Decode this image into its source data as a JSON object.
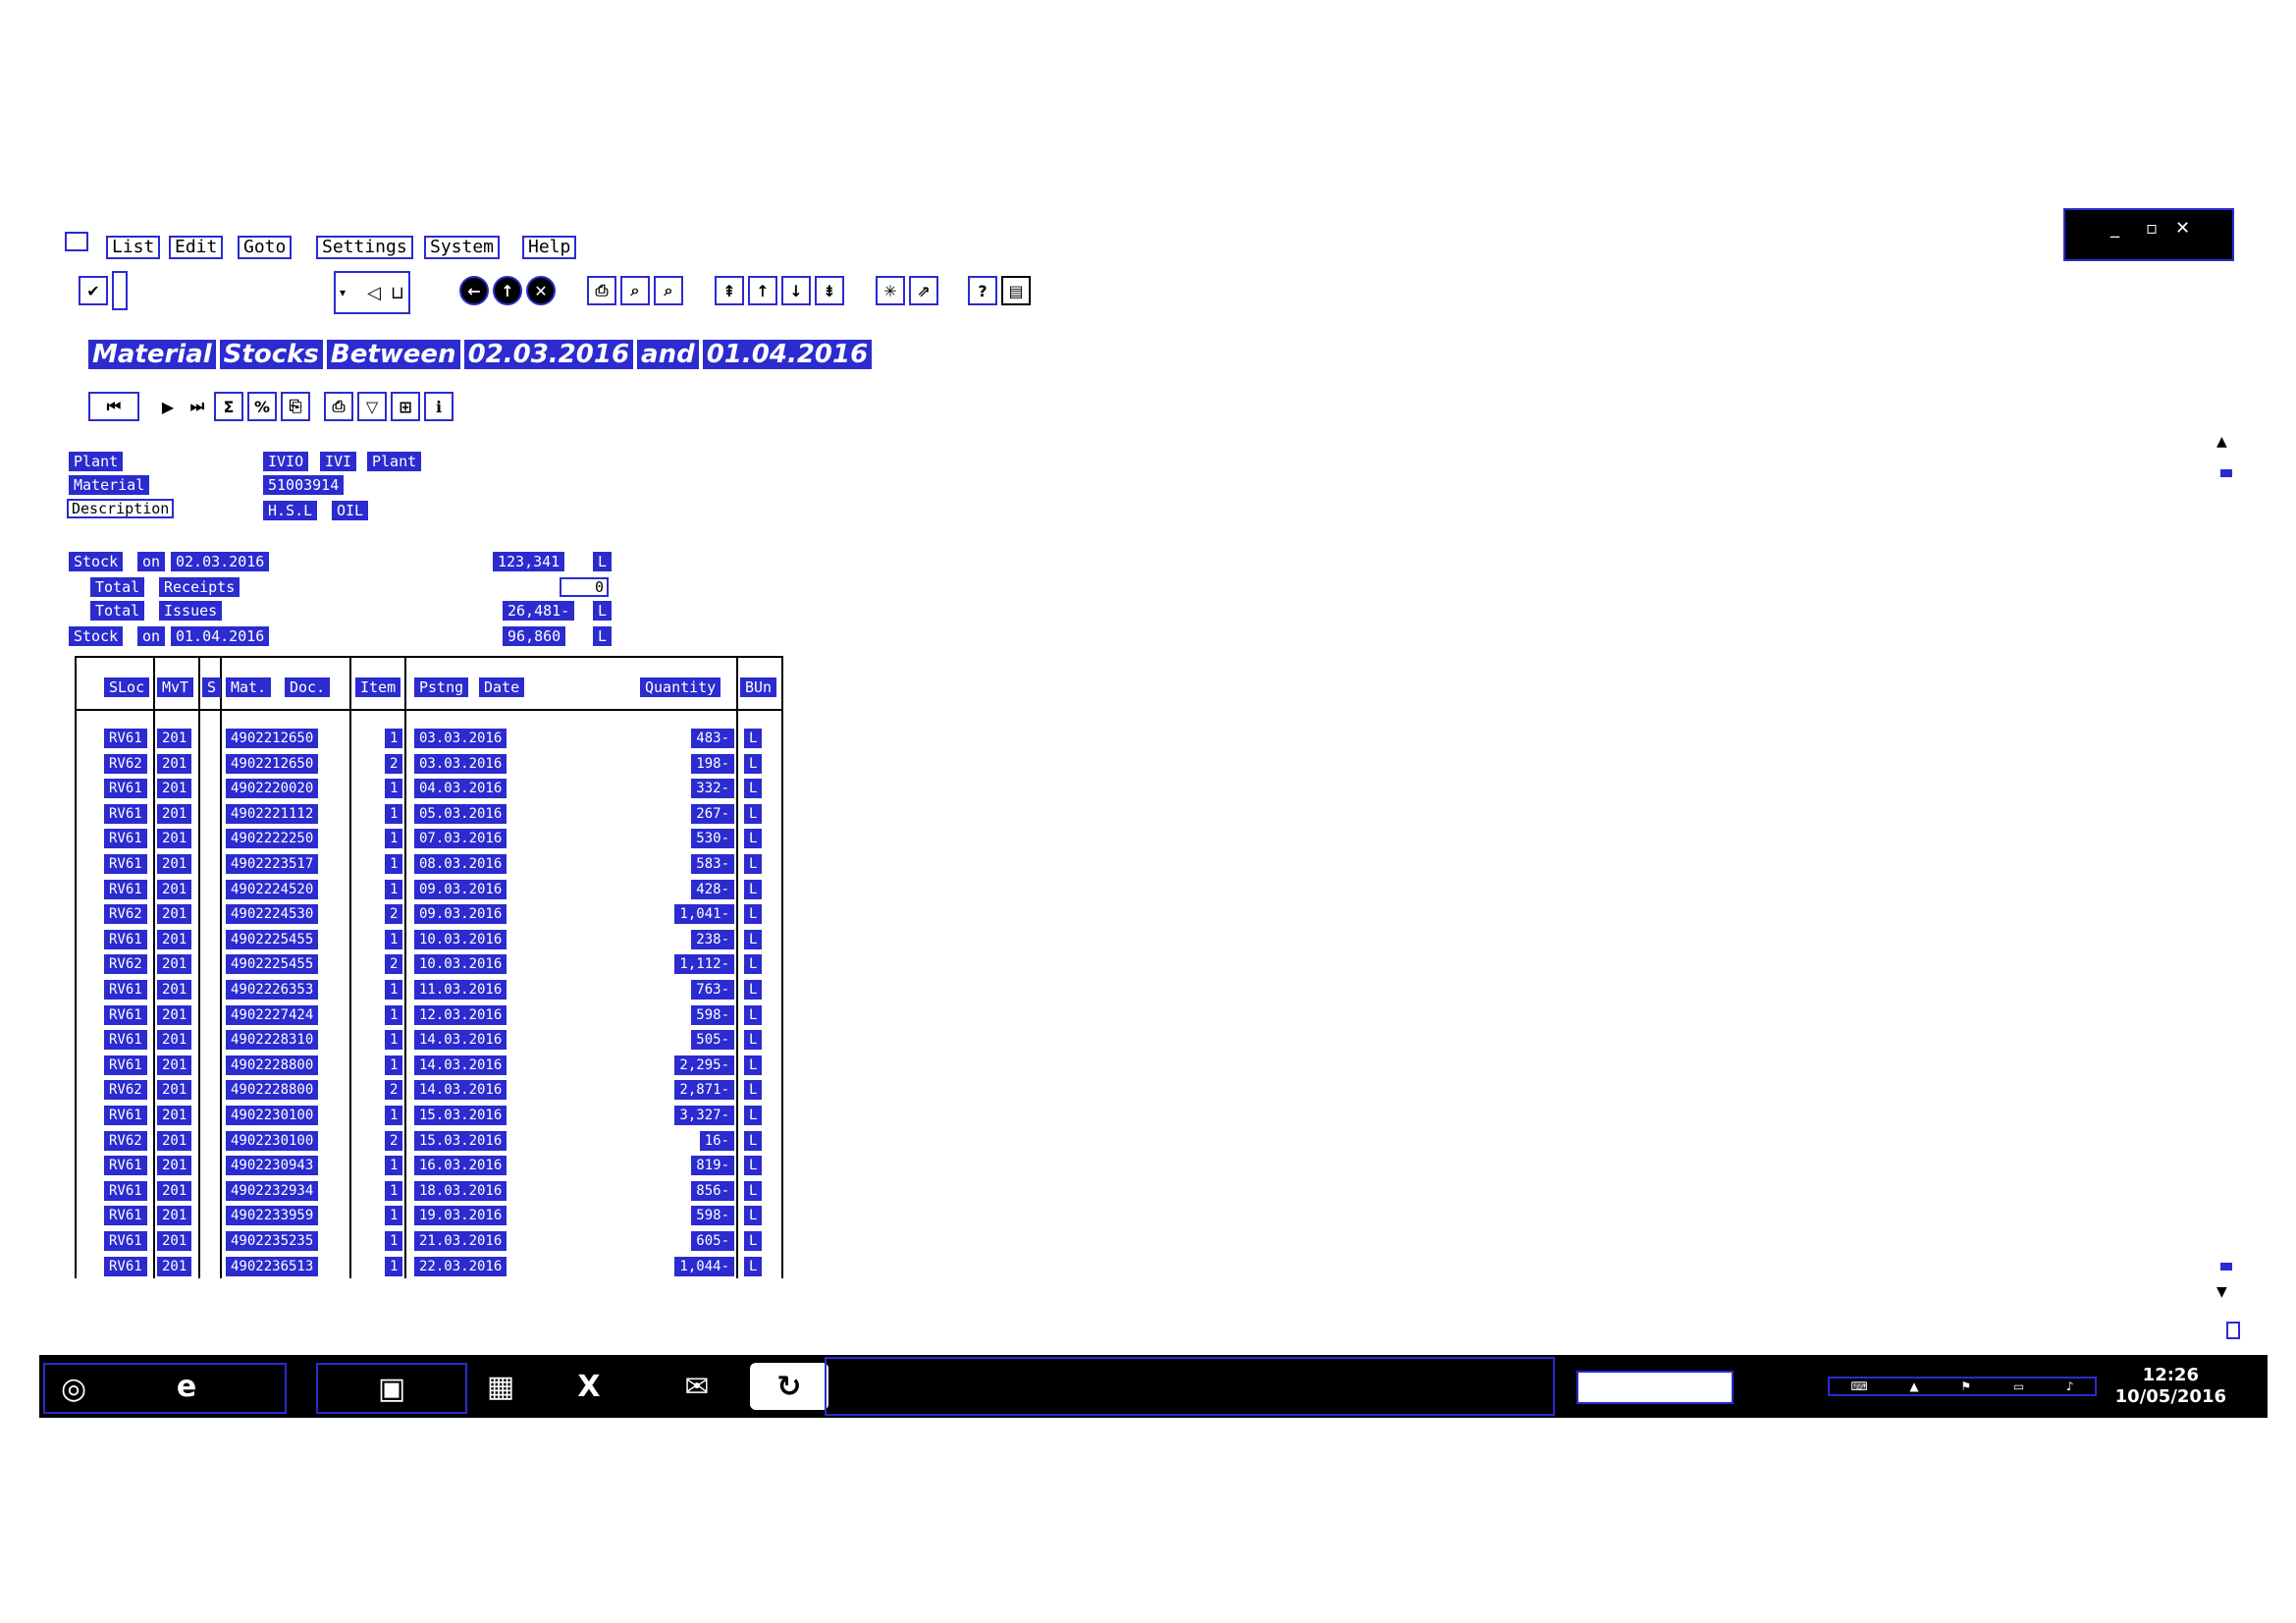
{
  "menu": {
    "items": [
      "List",
      "Edit",
      "Goto",
      "Settings",
      "System",
      "Help"
    ]
  },
  "window_controls": {
    "minimize": "_",
    "restore": "▫",
    "close": "✕"
  },
  "report_title": [
    "Material",
    "Stocks",
    "Between",
    "02.03.2016",
    "and",
    "01.04.2016"
  ],
  "header": {
    "plant_label": "Plant",
    "plant_value": [
      "IVIO",
      "IVI",
      "Plant"
    ],
    "material_label": "Material",
    "material_value": "51003914",
    "description_label": "Description",
    "description_value": [
      "H.S.L",
      "OIL"
    ]
  },
  "summary": {
    "stock_open_label": [
      "Stock",
      "on",
      "02.03.2016"
    ],
    "stock_open_value": "123,341",
    "receipts_label": [
      "Total",
      "Receipts"
    ],
    "receipts_value": "0",
    "issues_label": [
      "Total",
      "Issues"
    ],
    "issues_value": "26,481-",
    "stock_close_label": [
      "Stock",
      "on",
      "01.04.2016"
    ],
    "stock_close_value": "96,860",
    "unit": "L"
  },
  "table": {
    "columns": [
      "SLoc",
      "MvT",
      "S",
      "Mat.",
      "Doc.",
      "Item",
      "Pstng",
      "Date",
      "Quantity",
      "BUn"
    ],
    "rows": [
      {
        "sloc": "RV61",
        "mvt": "201",
        "doc": "4902212650",
        "item": "1",
        "date": "03.03.2016",
        "qty": "483-",
        "bun": "L"
      },
      {
        "sloc": "RV62",
        "mvt": "201",
        "doc": "4902212650",
        "item": "2",
        "date": "03.03.2016",
        "qty": "198-",
        "bun": "L"
      },
      {
        "sloc": "RV61",
        "mvt": "201",
        "doc": "4902220020",
        "item": "1",
        "date": "04.03.2016",
        "qty": "332-",
        "bun": "L"
      },
      {
        "sloc": "RV61",
        "mvt": "201",
        "doc": "4902221112",
        "item": "1",
        "date": "05.03.2016",
        "qty": "267-",
        "bun": "L"
      },
      {
        "sloc": "RV61",
        "mvt": "201",
        "doc": "4902222250",
        "item": "1",
        "date": "07.03.2016",
        "qty": "530-",
        "bun": "L"
      },
      {
        "sloc": "RV61",
        "mvt": "201",
        "doc": "4902223517",
        "item": "1",
        "date": "08.03.2016",
        "qty": "583-",
        "bun": "L"
      },
      {
        "sloc": "RV61",
        "mvt": "201",
        "doc": "4902224520",
        "item": "1",
        "date": "09.03.2016",
        "qty": "428-",
        "bun": "L"
      },
      {
        "sloc": "RV62",
        "mvt": "201",
        "doc": "4902224530",
        "item": "2",
        "date": "09.03.2016",
        "qty": "1,041-",
        "bun": "L"
      },
      {
        "sloc": "RV61",
        "mvt": "201",
        "doc": "4902225455",
        "item": "1",
        "date": "10.03.2016",
        "qty": "238-",
        "bun": "L"
      },
      {
        "sloc": "RV62",
        "mvt": "201",
        "doc": "4902225455",
        "item": "2",
        "date": "10.03.2016",
        "qty": "1,112-",
        "bun": "L"
      },
      {
        "sloc": "RV61",
        "mvt": "201",
        "doc": "4902226353",
        "item": "1",
        "date": "11.03.2016",
        "qty": "763-",
        "bun": "L"
      },
      {
        "sloc": "RV61",
        "mvt": "201",
        "doc": "4902227424",
        "item": "1",
        "date": "12.03.2016",
        "qty": "598-",
        "bun": "L"
      },
      {
        "sloc": "RV61",
        "mvt": "201",
        "doc": "4902228310",
        "item": "1",
        "date": "14.03.2016",
        "qty": "505-",
        "bun": "L"
      },
      {
        "sloc": "RV61",
        "mvt": "201",
        "doc": "4902228800",
        "item": "1",
        "date": "14.03.2016",
        "qty": "2,295-",
        "bun": "L"
      },
      {
        "sloc": "RV62",
        "mvt": "201",
        "doc": "4902228800",
        "item": "2",
        "date": "14.03.2016",
        "qty": "2,871-",
        "bun": "L"
      },
      {
        "sloc": "RV61",
        "mvt": "201",
        "doc": "4902230100",
        "item": "1",
        "date": "15.03.2016",
        "qty": "3,327-",
        "bun": "L"
      },
      {
        "sloc": "RV62",
        "mvt": "201",
        "doc": "4902230100",
        "item": "2",
        "date": "15.03.2016",
        "qty": "16-",
        "bun": "L"
      },
      {
        "sloc": "RV61",
        "mvt": "201",
        "doc": "4902230943",
        "item": "1",
        "date": "16.03.2016",
        "qty": "819-",
        "bun": "L"
      },
      {
        "sloc": "RV61",
        "mvt": "201",
        "doc": "4902232934",
        "item": "1",
        "date": "18.03.2016",
        "qty": "856-",
        "bun": "L"
      },
      {
        "sloc": "RV61",
        "mvt": "201",
        "doc": "4902233959",
        "item": "1",
        "date": "19.03.2016",
        "qty": "598-",
        "bun": "L"
      },
      {
        "sloc": "RV61",
        "mvt": "201",
        "doc": "4902235235",
        "item": "1",
        "date": "21.03.2016",
        "qty": "605-",
        "bun": "L"
      },
      {
        "sloc": "RV61",
        "mvt": "201",
        "doc": "4902236513",
        "item": "1",
        "date": "22.03.2016",
        "qty": "1,044-",
        "bun": "L"
      }
    ]
  },
  "taskbar": {
    "time": "12:26",
    "date": "10/05/2016"
  }
}
